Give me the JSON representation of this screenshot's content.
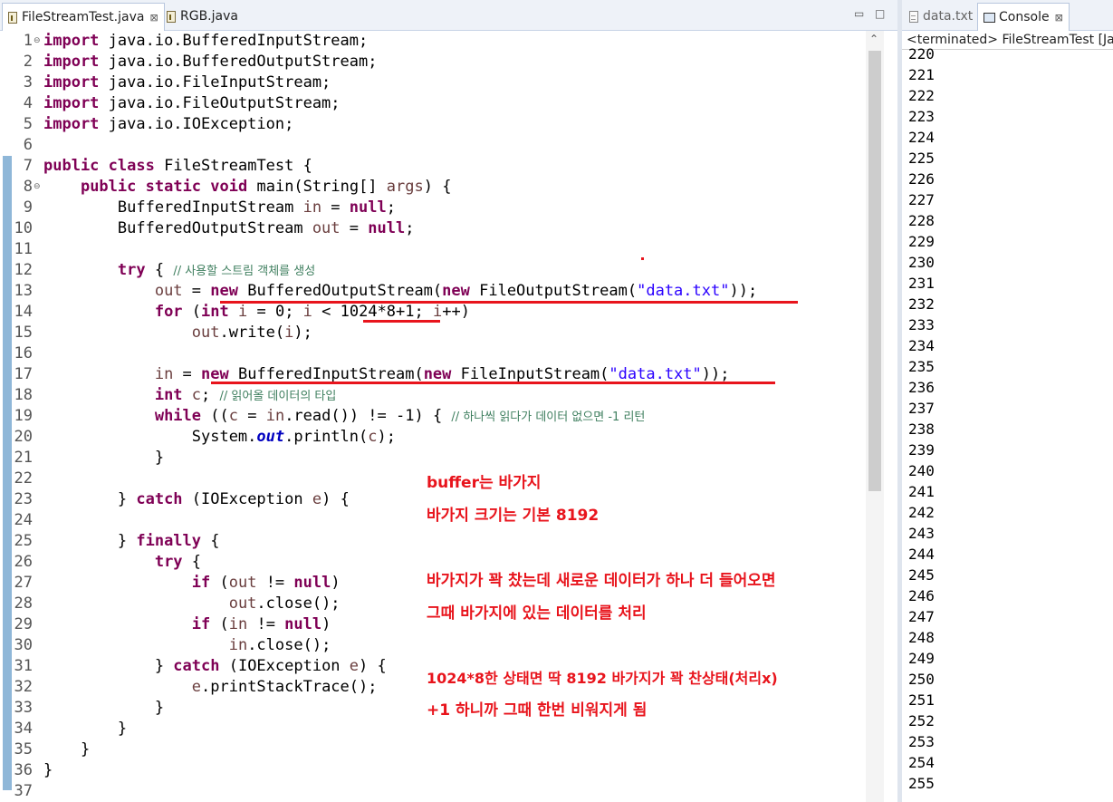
{
  "editor": {
    "tabs": [
      {
        "label": "FileStreamTest.java",
        "close": "⊠",
        "active": true
      },
      {
        "label": "RGB.java",
        "active": false
      }
    ],
    "minimize": "▭",
    "maximize": "□",
    "line_numbers": [
      "1",
      "2",
      "3",
      "4",
      "5",
      "6",
      "7",
      "8",
      "9",
      "10",
      "11",
      "12",
      "13",
      "14",
      "15",
      "16",
      "17",
      "18",
      "19",
      "20",
      "21",
      "22",
      "23",
      "24",
      "25",
      "26",
      "27",
      "28",
      "29",
      "30",
      "31",
      "32",
      "33",
      "34",
      "35",
      "36",
      "37"
    ],
    "fold_markers": {
      "line1": "⊖",
      "line8": "⊖"
    },
    "code": {
      "l1": [
        "import",
        " java.io.BufferedInputStream;"
      ],
      "l2": [
        "import",
        " java.io.BufferedOutputStream;"
      ],
      "l3": [
        "import",
        " java.io.FileInputStream;"
      ],
      "l4": [
        "import",
        " java.io.FileOutputStream;"
      ],
      "l5": [
        "import",
        " java.io.IOException;"
      ],
      "l7": [
        "public",
        " ",
        "class",
        " FileStreamTest {"
      ],
      "l8": [
        "    ",
        "public",
        " ",
        "static",
        " ",
        "void",
        " main(String[] ",
        "args",
        ") {"
      ],
      "l9": [
        "        BufferedInputStream ",
        "in",
        " = ",
        "null",
        ";"
      ],
      "l10": [
        "        BufferedOutputStream ",
        "out",
        " = ",
        "null",
        ";"
      ],
      "l12": [
        "        ",
        "try",
        " { ",
        "// 사용할 스트림 객체를 생성"
      ],
      "l13": [
        "            ",
        "out",
        " = ",
        "new",
        " BufferedOutputStream(",
        "new",
        " FileOutputStream(",
        "\"data.txt\"",
        "));"
      ],
      "l14": [
        "            ",
        "for",
        " (",
        "int",
        " ",
        "i",
        " = 0; ",
        "i",
        " < 1024*8+1; ",
        "i",
        "++)"
      ],
      "l15": [
        "                ",
        "out",
        ".write(",
        "i",
        ");"
      ],
      "l17": [
        "            ",
        "in",
        " = ",
        "new",
        " BufferedInputStream(",
        "new",
        " FileInputStream(",
        "\"data.txt\"",
        "));"
      ],
      "l18": [
        "            ",
        "int",
        " ",
        "c",
        "; ",
        "// 읽어올 데이터의 타입"
      ],
      "l19": [
        "            ",
        "while",
        " ((",
        "c",
        " = ",
        "in",
        ".read()) != -1) { ",
        "// 하나씩 읽다가 데이터 없으면 -1 리턴"
      ],
      "l20": [
        "                System.",
        "out",
        ".println(",
        "c",
        ");"
      ],
      "l21": [
        "            }"
      ],
      "l23": [
        "        } ",
        "catch",
        " (IOException ",
        "e",
        ") {"
      ],
      "l25": [
        "        } ",
        "finally",
        " {"
      ],
      "l26": [
        "            ",
        "try",
        " {"
      ],
      "l27": [
        "                ",
        "if",
        " (",
        "out",
        " != ",
        "null",
        ")"
      ],
      "l28": [
        "                    ",
        "out",
        ".close();"
      ],
      "l29": [
        "                ",
        "if",
        " (",
        "in",
        " != ",
        "null",
        ")"
      ],
      "l30": [
        "                    ",
        "in",
        ".close();"
      ],
      "l31": [
        "            } ",
        "catch",
        " (IOException ",
        "e",
        ") {"
      ],
      "l32": [
        "                ",
        "e",
        ".printStackTrace();"
      ],
      "l33": [
        "            }"
      ],
      "l34": [
        "        }"
      ],
      "l35": [
        "    }"
      ],
      "l36": [
        "}"
      ]
    },
    "annotations": [
      "buffer는 바가지",
      "바가지 크기는 기본 8192",
      "바가지가 꽉 찼는데 새로운 데이터가 하나 더 들어오면",
      "그때 바가지에 있는 데이터를 처리",
      "1024*8한 상태면 딱 8192 바가지가 꽉 찬상태(처리x)",
      "+1 하니까 그때 한번 비워지게 됨"
    ],
    "accent_color": "#e8141c",
    "scroll_up": "⌃"
  },
  "console": {
    "tabs": [
      {
        "label": "data.txt",
        "active": false
      },
      {
        "label": "Console",
        "close": "⊠",
        "active": true
      }
    ],
    "status": "<terminated> FileStreamTest [Java Application]",
    "output": [
      "220",
      "221",
      "222",
      "223",
      "224",
      "225",
      "226",
      "227",
      "228",
      "229",
      "230",
      "231",
      "232",
      "233",
      "234",
      "235",
      "236",
      "237",
      "238",
      "239",
      "240",
      "241",
      "242",
      "243",
      "244",
      "245",
      "246",
      "247",
      "248",
      "249",
      "250",
      "251",
      "252",
      "253",
      "254",
      "255"
    ]
  }
}
